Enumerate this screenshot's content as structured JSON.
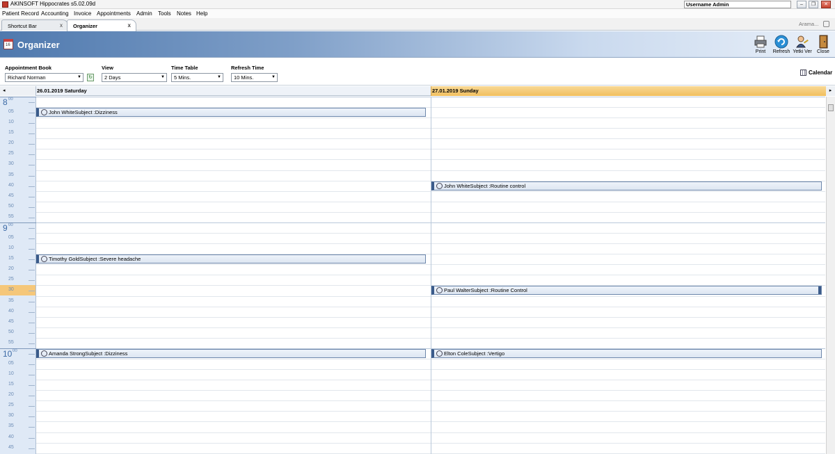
{
  "window": {
    "title": "AKINSOFT Hippocrates s5.02.09d",
    "user": "Username Admin",
    "buttons": {
      "minimize": "–",
      "restore": "❐",
      "close": "✕"
    }
  },
  "menu": {
    "items": [
      "Patient Record",
      "Accounting",
      "Invoice",
      "Appointments",
      "Admin",
      "Tools",
      "Notes",
      "Help"
    ]
  },
  "tabs": [
    {
      "label": "Shortcut Bar",
      "close": "x",
      "active": false
    },
    {
      "label": "Organizer",
      "close": "x",
      "active": true
    }
  ],
  "search": {
    "label": "Arama..."
  },
  "header": {
    "title": "Organizer",
    "toolbar": [
      {
        "label": "Print",
        "icon": "print-icon"
      },
      {
        "label": "Refresh",
        "icon": "refresh-icon"
      },
      {
        "label": "Yetki Ver",
        "icon": "authorize-icon"
      },
      {
        "label": "Close",
        "icon": "close-door-icon"
      }
    ]
  },
  "filters": {
    "appointment_book": {
      "label": "Appointment Book",
      "value": "Richard Norman"
    },
    "view": {
      "label": "View",
      "value": "2 Days"
    },
    "time_table": {
      "label": "Time Table",
      "value": "5 Mins."
    },
    "refresh_time": {
      "label": "Refresh Time",
      "value": "10 Mins."
    },
    "calendar_label": "Calendar"
  },
  "days": [
    {
      "label": "26.01.2019 Saturday",
      "highlight": false
    },
    {
      "label": "27.01.2019 Sunday",
      "highlight": true
    }
  ],
  "time_axis": {
    "hours": [
      "8",
      "9",
      "10"
    ],
    "hour_superscript": "00",
    "minutes": [
      "05",
      "10",
      "15",
      "20",
      "25",
      "30",
      "35",
      "40",
      "45",
      "50",
      "55"
    ],
    "current_slot": "9:30"
  },
  "appointments": [
    {
      "day": 0,
      "text": "John WhiteSubject :Dizziness"
    },
    {
      "day": 1,
      "text": "John WhiteSubject :Routine control"
    },
    {
      "day": 0,
      "text": "Timothy GoldSubject :Severe headache"
    },
    {
      "day": 1,
      "text": "Paul WalterSubject :Routine Control"
    },
    {
      "day": 0,
      "text": "Amanda StrongSubject :Dizziness"
    },
    {
      "day": 1,
      "text": "Elton ColeSubject :Vertigo"
    }
  ],
  "colors": {
    "header_start": "#4f79ae",
    "day_highlight": "#f5c76e",
    "time_column": "#dfe9f6",
    "current_slot": "#f5c77a",
    "appointment_border": "#3b5b8a"
  }
}
